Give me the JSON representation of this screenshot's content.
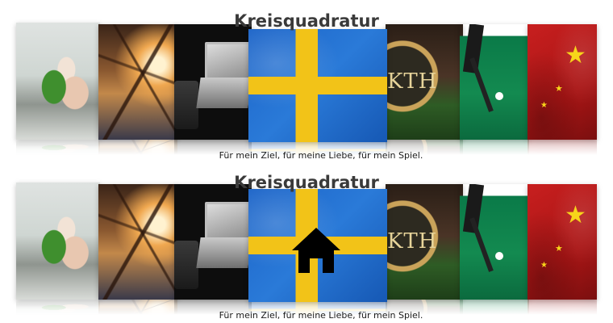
{
  "coverflows": [
    {
      "title": "Kreisquadratur",
      "caption": "Für mein Ziel, für meine Liebe, für mein Spiel.",
      "covers": [
        "spring-rolls-photo",
        "sailing-ship-photo",
        "laptop-photo",
        "swedish-flag-photo",
        "kth-logo-photo",
        "field-hockey-photo",
        "chinese-flag-photo"
      ],
      "selected_index": 3,
      "overlay_icon": null
    },
    {
      "title": "Kreisquadratur",
      "caption": "Für mein Ziel, für meine Liebe, für mein Spiel.",
      "covers": [
        "spring-rolls-photo",
        "sailing-ship-photo",
        "laptop-photo",
        "swedish-flag-photo",
        "kth-logo-photo",
        "field-hockey-photo",
        "chinese-flag-photo"
      ],
      "selected_index": 3,
      "overlay_icon": "home-icon"
    }
  ],
  "kth_logo_text": "KTH",
  "colors": {
    "swedish_blue": "#1c64c8",
    "swedish_yellow": "#f2c318",
    "china_red": "#c81f1f",
    "star_yellow": "#f7d51a"
  }
}
